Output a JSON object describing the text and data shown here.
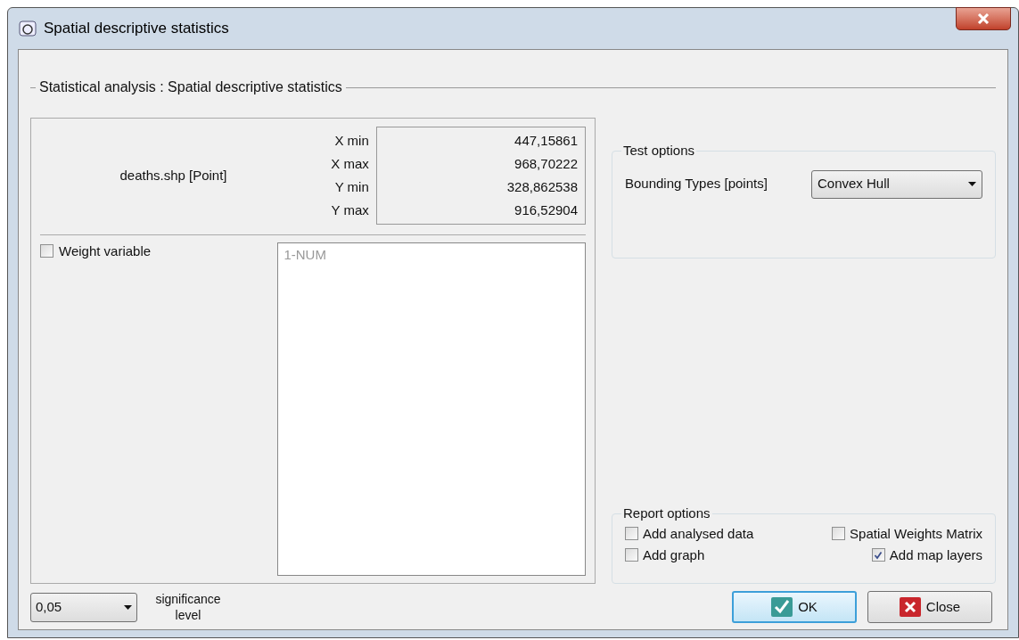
{
  "window": {
    "title": "Spatial descriptive statistics"
  },
  "section_title": "Statistical analysis : Spatial descriptive statistics",
  "layer": {
    "name": "deaths.shp [Point]",
    "extent": [
      {
        "label": "X min",
        "value": "447,15861"
      },
      {
        "label": "X max",
        "value": "968,70222"
      },
      {
        "label": "Y min",
        "value": "328,862538"
      },
      {
        "label": "Y max",
        "value": "916,52904"
      }
    ]
  },
  "weight_variable": {
    "label": "Weight variable",
    "checked": false,
    "variables": [
      "1-NUM"
    ]
  },
  "significance": {
    "value": "0,05",
    "label": "significance level"
  },
  "test_options": {
    "title": "Test options",
    "fields": [
      {
        "label": "Bounding Types [points]",
        "value": "Convex Hull"
      }
    ]
  },
  "report_options": {
    "title": "Report options",
    "items": [
      {
        "label": "Add analysed data",
        "checked": false
      },
      {
        "label": "Spatial Weights Matrix",
        "checked": false
      },
      {
        "label": "Add graph",
        "checked": false
      },
      {
        "label": "Add map layers",
        "checked": true
      }
    ]
  },
  "buttons": [
    {
      "kind": "ok",
      "label": "OK"
    },
    {
      "kind": "close",
      "label": "Close"
    }
  ]
}
